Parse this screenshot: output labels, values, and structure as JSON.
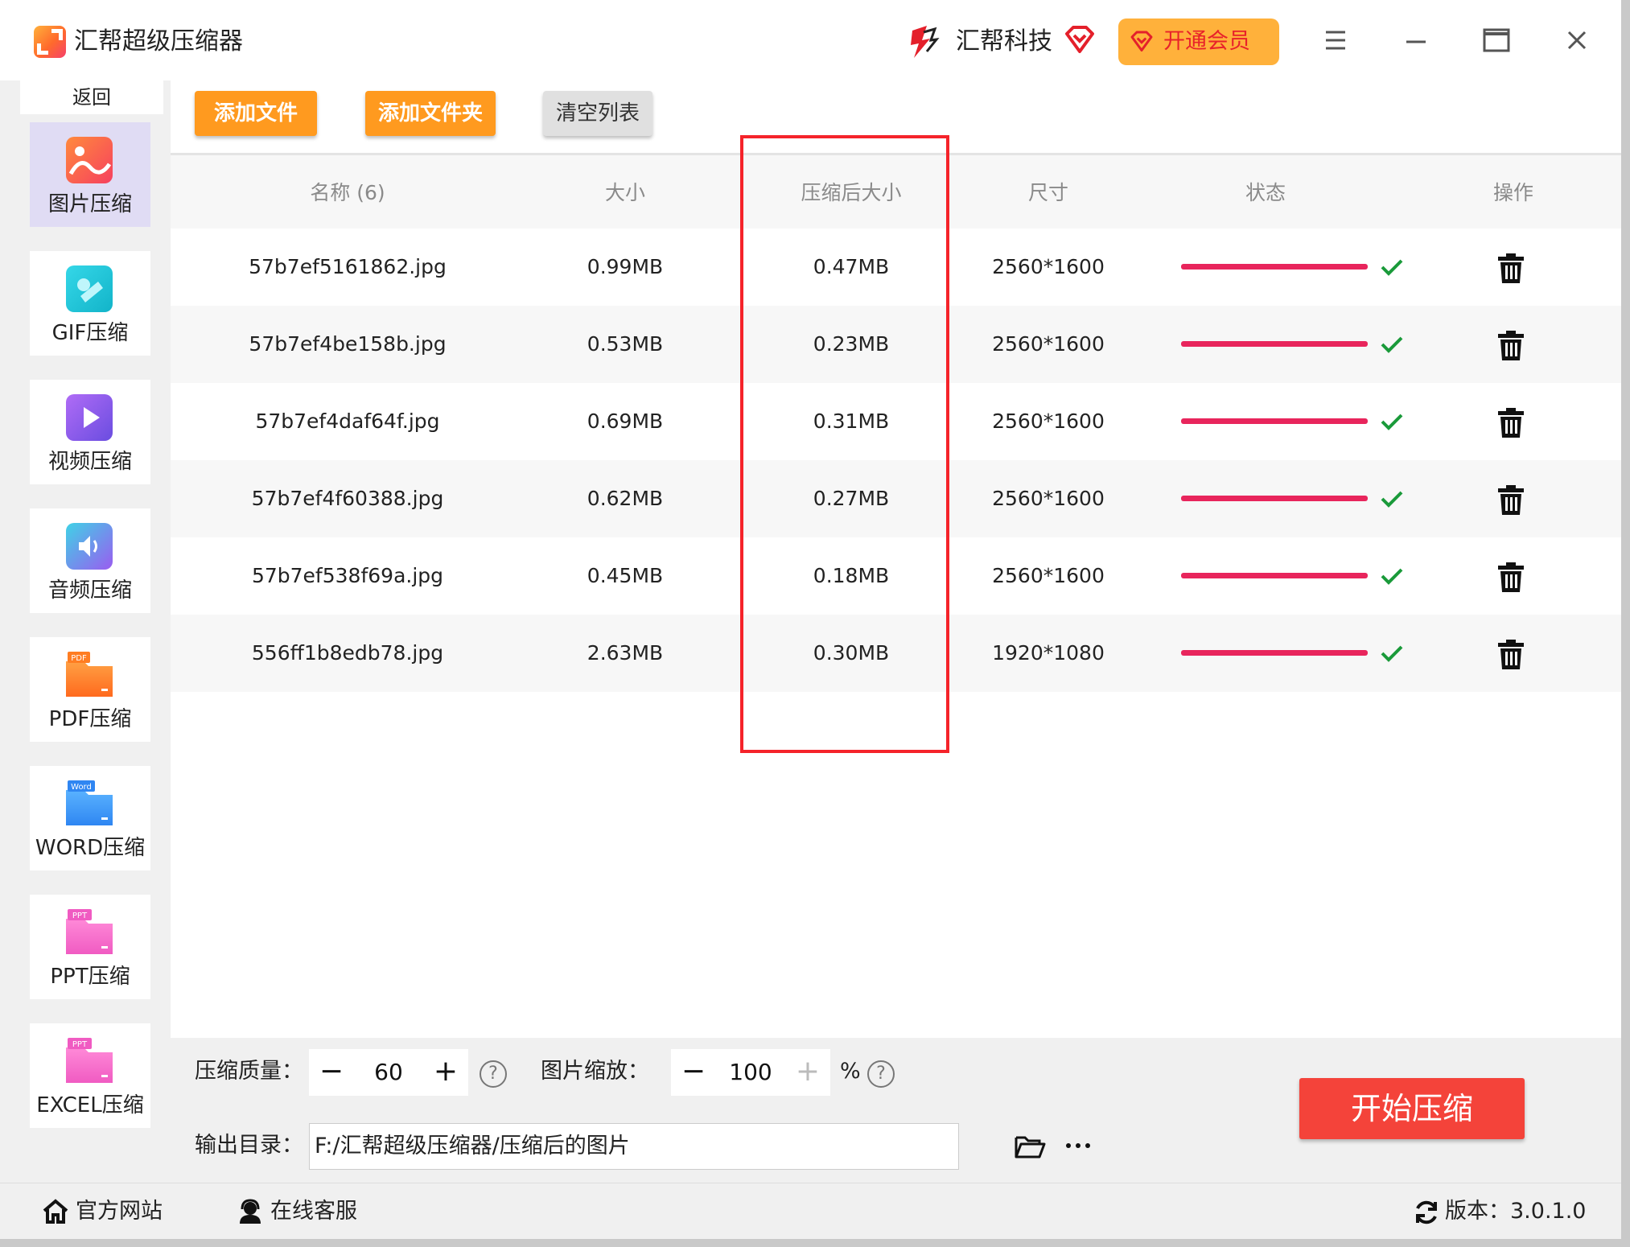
{
  "titlebar": {
    "app_title": "汇帮超级压缩器",
    "brand": "汇帮科技",
    "vip_label": "开通会员"
  },
  "sidebar": {
    "back_label": "返回",
    "items": [
      {
        "label": "图片压缩",
        "icon": "image-icon",
        "active": true
      },
      {
        "label": "GIF压缩",
        "icon": "gif-icon"
      },
      {
        "label": "视频压缩",
        "icon": "video-icon"
      },
      {
        "label": "音频压缩",
        "icon": "audio-icon"
      },
      {
        "label": "PDF压缩",
        "icon": "pdf-icon",
        "badge": "PDF"
      },
      {
        "label": "WORD压缩",
        "icon": "word-icon",
        "badge": "Word"
      },
      {
        "label": "PPT压缩",
        "icon": "ppt-icon",
        "badge": "PPT"
      },
      {
        "label": "EXCEL压缩",
        "icon": "excel-icon",
        "badge": "PPT"
      }
    ]
  },
  "toolbar": {
    "add_file": "添加文件",
    "add_folder": "添加文件夹",
    "clear_list": "清空列表"
  },
  "table": {
    "headers": {
      "name": "名称 (6)",
      "size": "大小",
      "compressed": "压缩后大小",
      "dimensions": "尺寸",
      "status": "状态",
      "actions": "操作"
    },
    "rows": [
      {
        "name": "57b7ef5161862.jpg",
        "size": "0.99MB",
        "compressed": "0.47MB",
        "dimensions": "2560*1600",
        "progress": 1.0
      },
      {
        "name": "57b7ef4be158b.jpg",
        "size": "0.53MB",
        "compressed": "0.23MB",
        "dimensions": "2560*1600",
        "progress": 1.0
      },
      {
        "name": "57b7ef4daf64f.jpg",
        "size": "0.69MB",
        "compressed": "0.31MB",
        "dimensions": "2560*1600",
        "progress": 1.0
      },
      {
        "name": "57b7ef4f60388.jpg",
        "size": "0.62MB",
        "compressed": "0.27MB",
        "dimensions": "2560*1600",
        "progress": 1.0
      },
      {
        "name": "57b7ef538f69a.jpg",
        "size": "0.45MB",
        "compressed": "0.18MB",
        "dimensions": "2560*1600",
        "progress": 1.0
      },
      {
        "name": "556ff1b8edb78.jpg",
        "size": "2.63MB",
        "compressed": "0.30MB",
        "dimensions": "1920*1080",
        "progress": 1.0
      }
    ]
  },
  "settings": {
    "quality_label": "压缩质量：",
    "quality_value": "60",
    "scale_label": "图片缩放：",
    "scale_value": "100",
    "scale_unit": "%",
    "output_label": "输出目录：",
    "output_path": "F:/汇帮超级压缩器/压缩后的图片",
    "start_label": "开始压缩"
  },
  "footer": {
    "website": "官方网站",
    "support": "在线客服",
    "version": "版本：3.0.1.0"
  },
  "colors": {
    "accent_orange": "#ff9a1f",
    "start_red": "#f4433a",
    "progress_pink": "#e8255c",
    "check_green": "#1a9a3a",
    "highlight_red": "#f5232a"
  }
}
